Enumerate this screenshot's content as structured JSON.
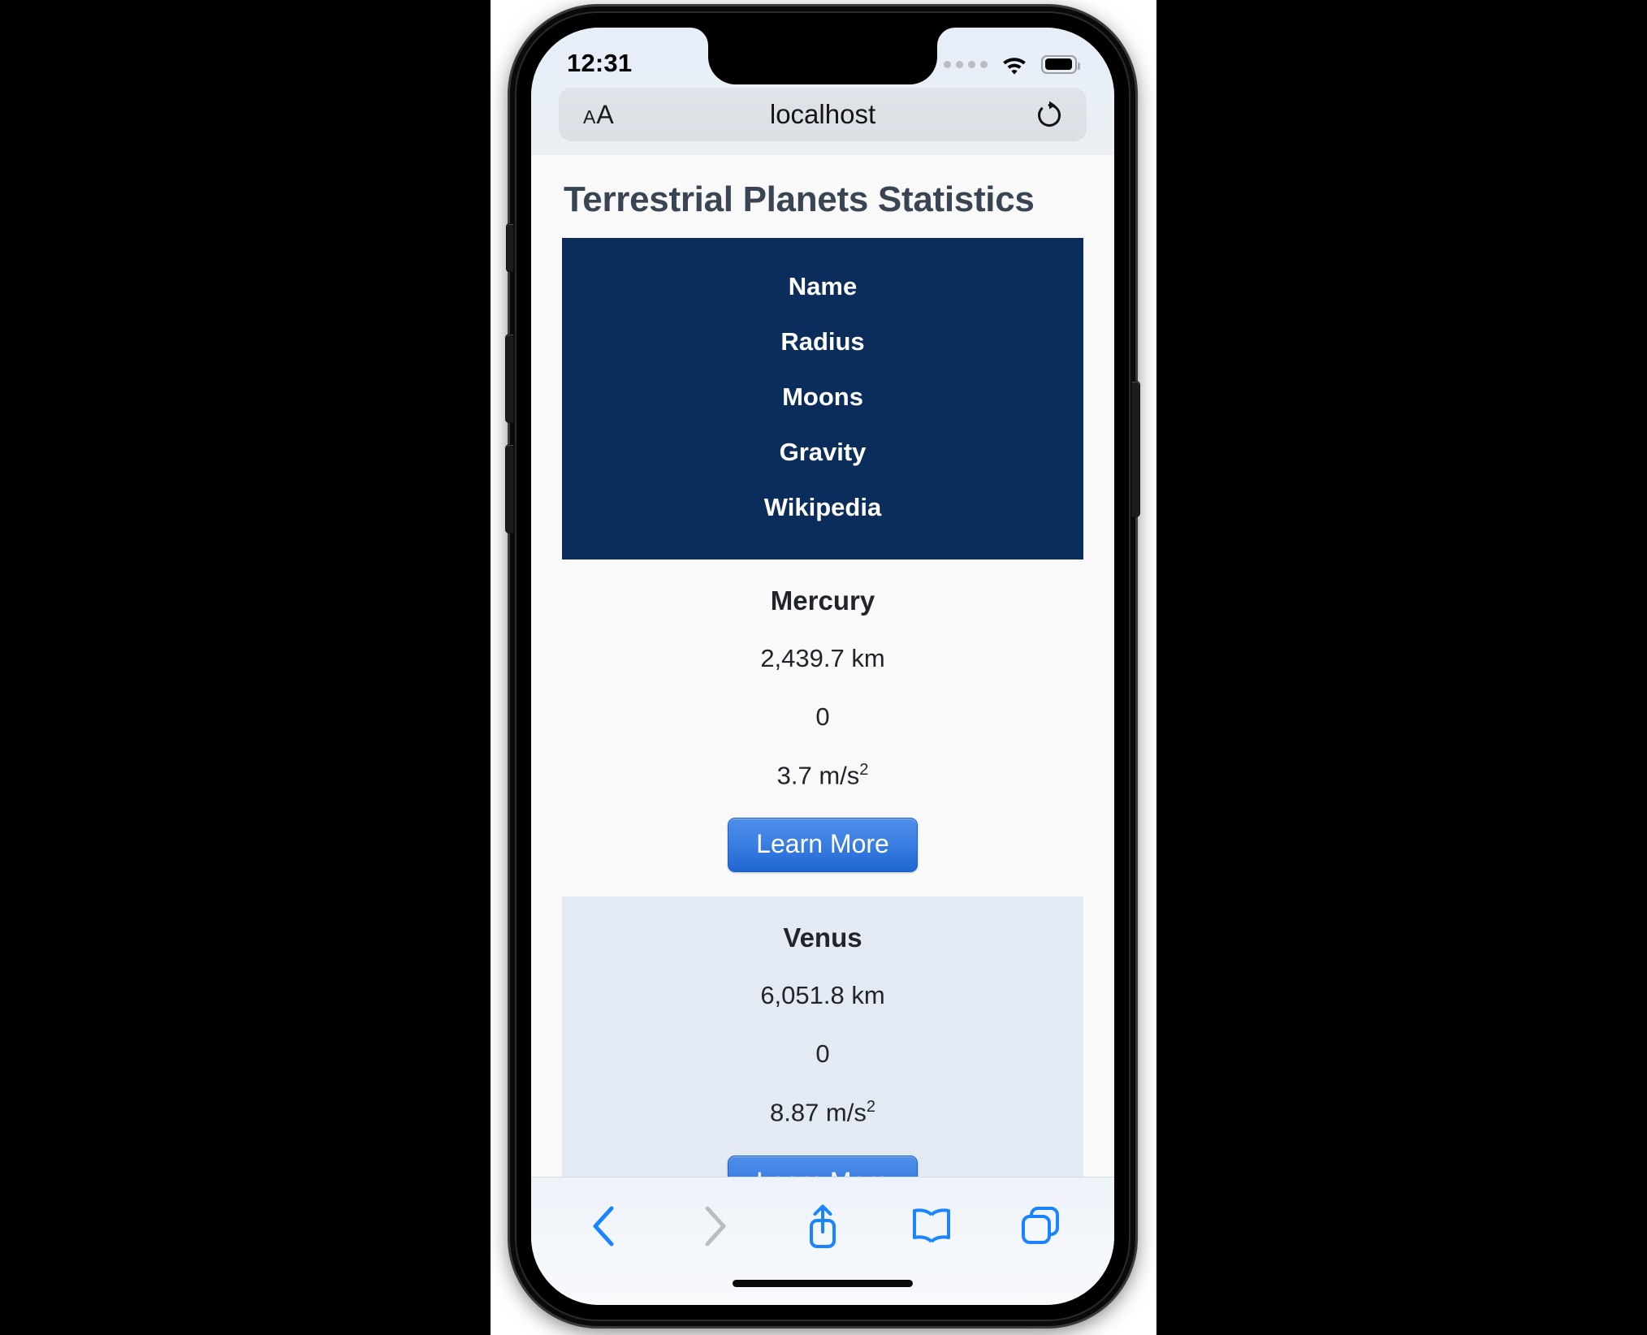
{
  "device": {
    "type": "iphone",
    "side_buttons": [
      "mute-switch",
      "volume-up",
      "volume-down",
      "power"
    ]
  },
  "statusbar": {
    "time": "12:31",
    "signal_icon": "cellular-dots-icon",
    "wifi_icon": "wifi-icon",
    "battery_icon": "battery-icon"
  },
  "browser": {
    "name": "Safari",
    "font_size_button": {
      "small_a": "A",
      "large_a": "A"
    },
    "url": "localhost",
    "reload_icon": "reload-icon",
    "toolbar": [
      {
        "name": "back-button",
        "icon": "chevron-left-icon",
        "enabled": true,
        "color": "#1a84ff"
      },
      {
        "name": "forward-button",
        "icon": "chevron-right-icon",
        "enabled": false,
        "color": "#b9bcc0"
      },
      {
        "name": "share-button",
        "icon": "share-icon",
        "enabled": true,
        "color": "#1a84ff"
      },
      {
        "name": "bookmarks-button",
        "icon": "book-icon",
        "enabled": true,
        "color": "#1a84ff"
      },
      {
        "name": "tabs-button",
        "icon": "tabs-icon",
        "enabled": true,
        "color": "#1a84ff"
      }
    ]
  },
  "page": {
    "title": "Terrestrial Planets Statistics",
    "title_color": "#3a4553",
    "header_bg": "#0b2d5c",
    "stripe_bg": "#e3eaf4",
    "base_bg": "#f9f9fa",
    "columns": [
      "Name",
      "Radius",
      "Moons",
      "Gravity",
      "Wikipedia"
    ],
    "rows": [
      {
        "name": "Mercury",
        "radius": "2,439.7 km",
        "moons": "0",
        "gravity_value": "3.7 m/s",
        "gravity_exp": "2",
        "link_label": "Learn More"
      },
      {
        "name": "Venus",
        "radius": "6,051.8 km",
        "moons": "0",
        "gravity_value": "8.87 m/s",
        "gravity_exp": "2",
        "link_label": "Learn More"
      }
    ]
  }
}
